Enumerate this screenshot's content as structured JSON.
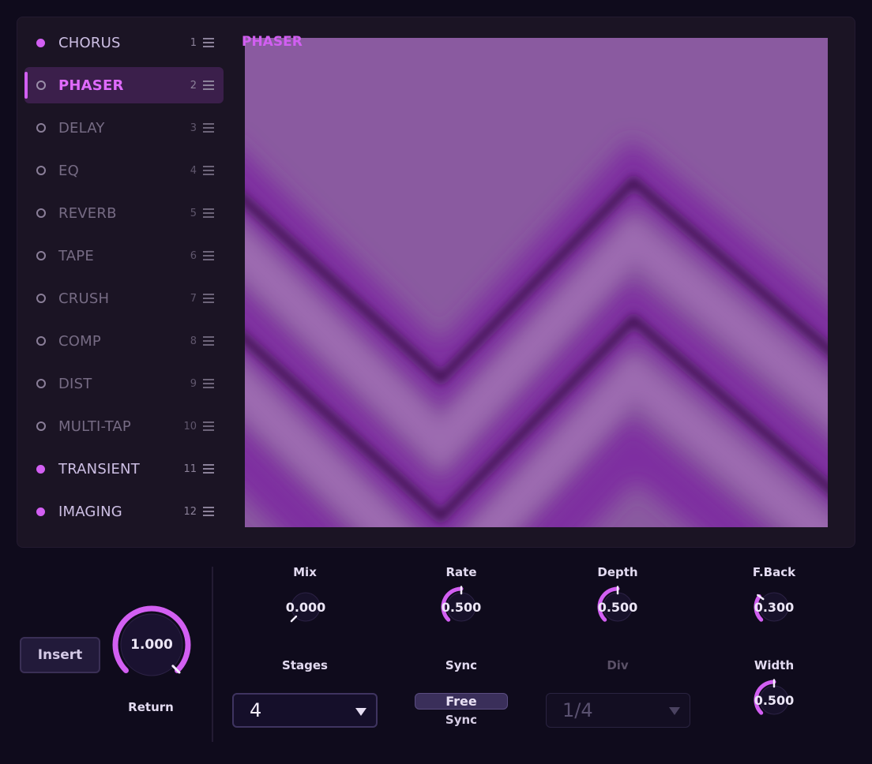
{
  "effects": [
    {
      "label": "CHORUS",
      "index": "1",
      "state": "on"
    },
    {
      "label": "PHASER",
      "index": "2",
      "state": "selected"
    },
    {
      "label": "DELAY",
      "index": "3",
      "state": "off"
    },
    {
      "label": "EQ",
      "index": "4",
      "state": "off"
    },
    {
      "label": "REVERB",
      "index": "5",
      "state": "off"
    },
    {
      "label": "TAPE",
      "index": "6",
      "state": "off"
    },
    {
      "label": "CRUSH",
      "index": "7",
      "state": "off"
    },
    {
      "label": "COMP",
      "index": "8",
      "state": "off"
    },
    {
      "label": "DIST",
      "index": "9",
      "state": "off"
    },
    {
      "label": "MULTI-TAP",
      "index": "10",
      "state": "off"
    },
    {
      "label": "TRANSIENT",
      "index": "11",
      "state": "on"
    },
    {
      "label": "IMAGING",
      "index": "12",
      "state": "on"
    }
  ],
  "visualizer": {
    "title": "PHASER"
  },
  "insert": {
    "label": "Insert"
  },
  "return_knob": {
    "label": "Return",
    "value": "1.000",
    "level": 1.0
  },
  "params": {
    "mix": {
      "label": "Mix",
      "value": "0.000",
      "level": 0.0
    },
    "rate": {
      "label": "Rate",
      "value": "0.500",
      "level": 0.5
    },
    "depth": {
      "label": "Depth",
      "value": "0.500",
      "level": 0.5
    },
    "feedback": {
      "label": "F.Back",
      "value": "0.300",
      "level": 0.3
    },
    "width": {
      "label": "Width",
      "value": "0.500",
      "level": 0.5
    },
    "stages": {
      "label": "Stages",
      "value": "4"
    },
    "sync": {
      "label": "Sync",
      "button": "Free",
      "sub_label": "Sync"
    },
    "div": {
      "label": "Div",
      "value": "1/4",
      "enabled": false
    }
  },
  "colors": {
    "accent": "#d25ff2",
    "background": "#0f0b1c",
    "panel": "#1b1424"
  }
}
